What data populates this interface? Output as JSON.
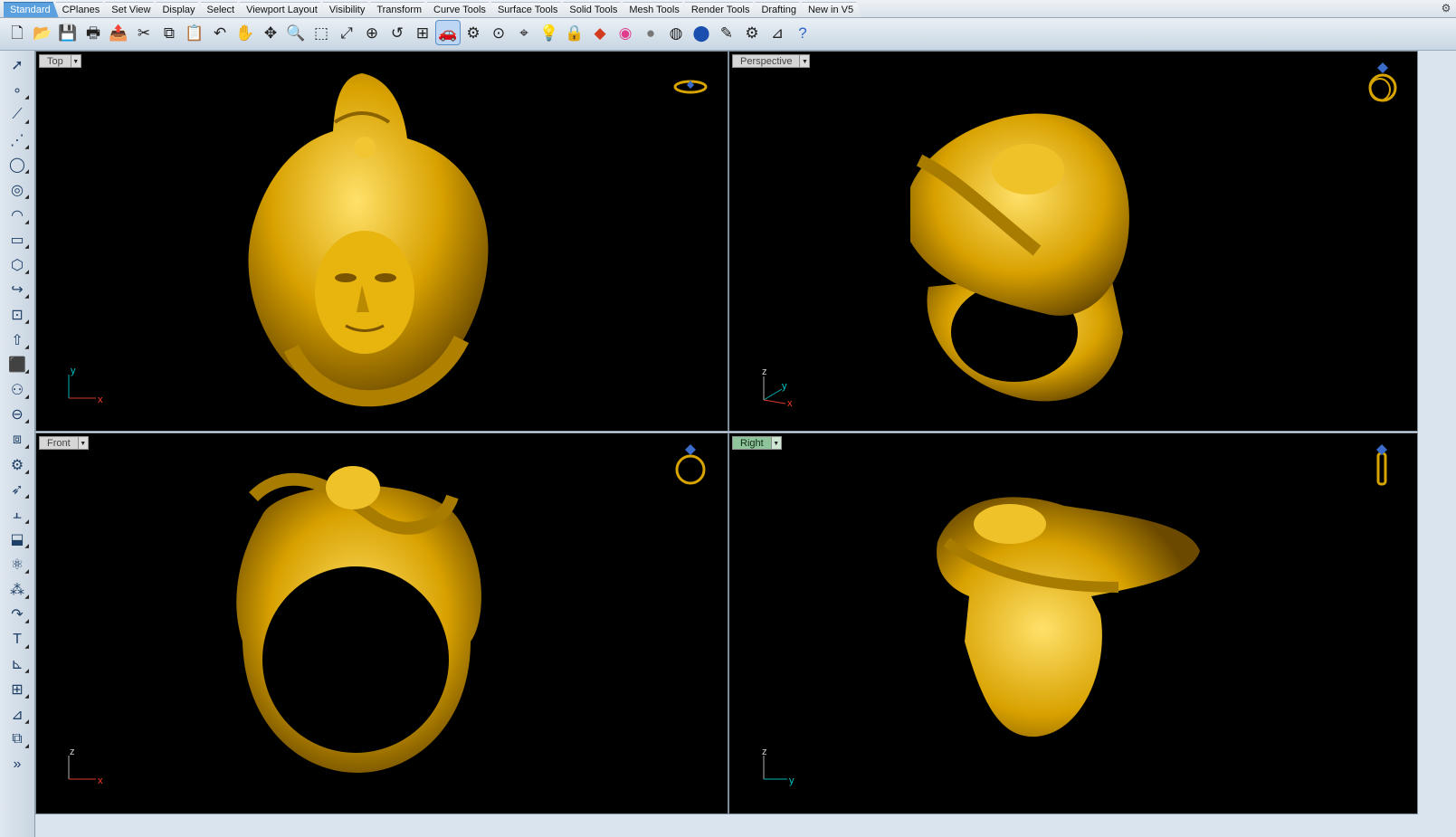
{
  "tabs": [
    "Standard",
    "CPlanes",
    "Set View",
    "Display",
    "Select",
    "Viewport Layout",
    "Visibility",
    "Transform",
    "Curve Tools",
    "Surface Tools",
    "Solid Tools",
    "Mesh Tools",
    "Render Tools",
    "Drafting",
    "New in V5"
  ],
  "active_tab": "Standard",
  "toolbar_icons": [
    "new-file",
    "open-folder",
    "save",
    "print",
    "export",
    "cut",
    "copy",
    "paste",
    "undo",
    "pan-hand",
    "rotate-view",
    "zoom-in",
    "zoom-window",
    "zoom-extents",
    "zoom-selected",
    "zoom-previous",
    "four-views",
    "car-shade",
    "drive",
    "ortho",
    "snap",
    "light-bulb",
    "lock",
    "layer-color",
    "color-wheel",
    "render-sphere",
    "render-preview",
    "shaded-sphere",
    "properties",
    "settings-gears",
    "dimension",
    "help"
  ],
  "left_icons": [
    "select-arrow",
    "point",
    "polyline",
    "curve-point",
    "circle",
    "ellipse",
    "arc",
    "rectangle",
    "polygon",
    "fillet-curve",
    "surface-from-points",
    "extrude",
    "box",
    "sphere-union",
    "cylinder",
    "mesh",
    "transform-gears",
    "move-arrow",
    "align",
    "extrude-face",
    "boolean",
    "array",
    "edit-curve",
    "text",
    "dimension-tool",
    "block",
    "analysis",
    "cage",
    "more"
  ],
  "viewports": {
    "top": {
      "label": "Top",
      "axis_a": "y",
      "axis_b": "x"
    },
    "persp": {
      "label": "Perspective",
      "axis_a": "z",
      "axis_b": "y",
      "axis_c": "x"
    },
    "front": {
      "label": "Front",
      "axis_a": "z",
      "axis_b": "x"
    },
    "right": {
      "label": "Right",
      "axis_a": "z",
      "axis_b": "y"
    }
  },
  "active_viewport": "Right",
  "colors": {
    "gold": "#d7a400",
    "viewport_bg": "#000000",
    "active_label": "#8fc49b",
    "tab_active": "#5ba0df"
  }
}
